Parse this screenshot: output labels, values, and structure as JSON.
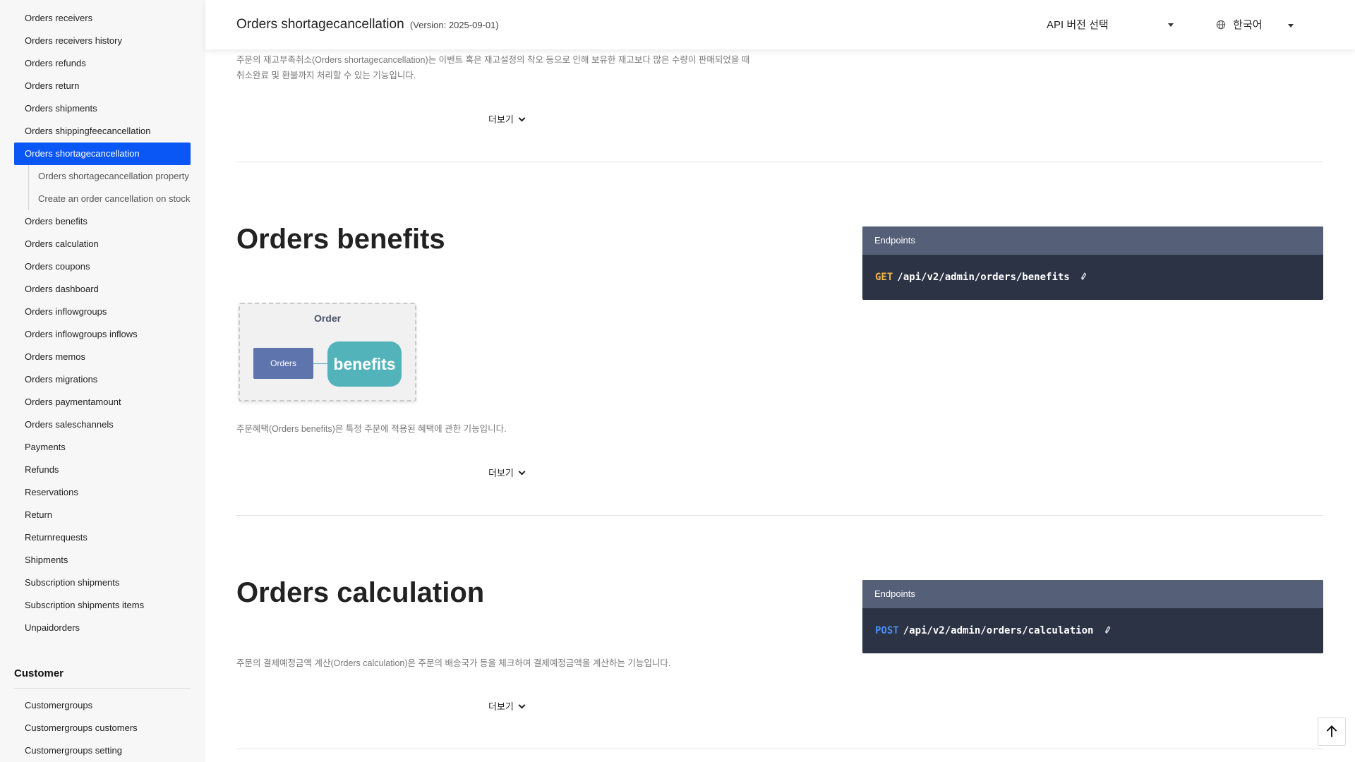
{
  "sidebar": {
    "items_top": [
      {
        "label": "Orders receivers"
      },
      {
        "label": "Orders receivers history"
      },
      {
        "label": "Orders refunds"
      },
      {
        "label": "Orders return"
      },
      {
        "label": "Orders shipments"
      },
      {
        "label": "Orders shippingfeecancellation"
      }
    ],
    "active_item": "Orders shortagecancellation",
    "sub_items": [
      {
        "label": "Orders shortagecancellation property list"
      },
      {
        "label": "Create an order cancellation on stock shortage"
      }
    ],
    "items_rest": [
      {
        "label": "Orders benefits"
      },
      {
        "label": "Orders calculation"
      },
      {
        "label": "Orders coupons"
      },
      {
        "label": "Orders dashboard"
      },
      {
        "label": "Orders inflowgroups"
      },
      {
        "label": "Orders inflowgroups inflows"
      },
      {
        "label": "Orders memos"
      },
      {
        "label": "Orders migrations"
      },
      {
        "label": "Orders paymentamount"
      },
      {
        "label": "Orders saleschannels"
      },
      {
        "label": "Payments"
      },
      {
        "label": "Refunds"
      },
      {
        "label": "Reservations"
      },
      {
        "label": "Return"
      },
      {
        "label": "Returnrequests"
      },
      {
        "label": "Shipments"
      },
      {
        "label": "Subscription shipments"
      },
      {
        "label": "Subscription shipments items"
      },
      {
        "label": "Unpaidorders"
      }
    ],
    "section_customer": "Customer",
    "customer_items": [
      {
        "label": "Customergroups"
      },
      {
        "label": "Customergroups customers"
      },
      {
        "label": "Customergroups setting"
      }
    ]
  },
  "header": {
    "title": "Orders shortagecancellation",
    "version": "(Version: 2025-09-01)",
    "version_select": "API 버전 선택",
    "language": "한국어"
  },
  "sections": {
    "shortage": {
      "desc_line1": "주문의 재고부족취소(Orders shortagecancellation)는 이벤트 혹은 재고설정의 착오 등으로 인해 보유한 재고보다 많은 수량이 판매되었을 때",
      "desc_line2": "취소완료 및 환불까지 처리할 수 있는 기능입니다.",
      "more": "더보기"
    },
    "benefits": {
      "title": "Orders benefits",
      "endpoints_label": "Endpoints",
      "method": "GET",
      "path": "/api/v2/admin/orders/benefits",
      "diagram": {
        "title": "Order",
        "node_left": "Orders",
        "node_right": "benefits"
      },
      "desc": "주문혜택(Orders benefits)은 특정 주문에 적용된 혜택에 관한 기능입니다.",
      "more": "더보기"
    },
    "calculation": {
      "title": "Orders calculation",
      "endpoints_label": "Endpoints",
      "method": "POST",
      "path": "/api/v2/admin/orders/calculation",
      "desc": "주문의 결제예정금액 계산(Orders calculation)은 주문의 배송국가 등을 체크하여 결제예정금액을 계산하는 기능입니다.",
      "more": "더보기"
    }
  },
  "icons": {
    "globe": "globe-icon",
    "link": "link-icon",
    "to_top": "arrow-up-icon"
  },
  "colors": {
    "accent": "#0b57f5",
    "get": "#f3b24a",
    "post": "#4a8cf5",
    "endpoint_bg": "#2c3345"
  }
}
